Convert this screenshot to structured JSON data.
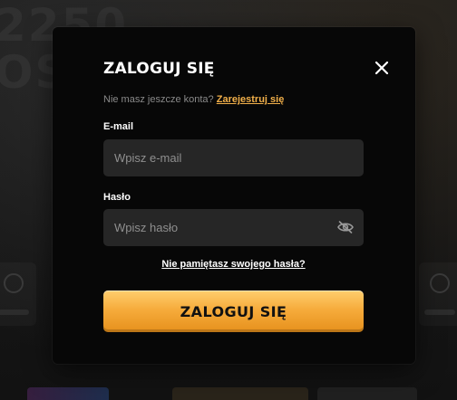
{
  "background": {
    "text_lines": [
      "2250",
      "OS"
    ]
  },
  "login_modal": {
    "title": "ZALOGUJ SIĘ",
    "signup_prompt": "Nie masz jeszcze konta?",
    "signup_link": "Zarejestruj się",
    "email": {
      "label": "E-mail",
      "placeholder": "Wpisz e-mail",
      "value": ""
    },
    "password": {
      "label": "Hasło",
      "placeholder": "Wpisz hasło",
      "value": ""
    },
    "forgot_password": "Nie pamiętasz swojego hasła?",
    "submit_label": "ZALOGUJ SIĘ",
    "icons": {
      "close": "close-icon",
      "password_visibility": "eye-off-icon"
    },
    "colors": {
      "accent": "#f6ac3c",
      "link": "#f2b04a",
      "modal_bg": "#070707",
      "input_bg": "#262626"
    }
  }
}
